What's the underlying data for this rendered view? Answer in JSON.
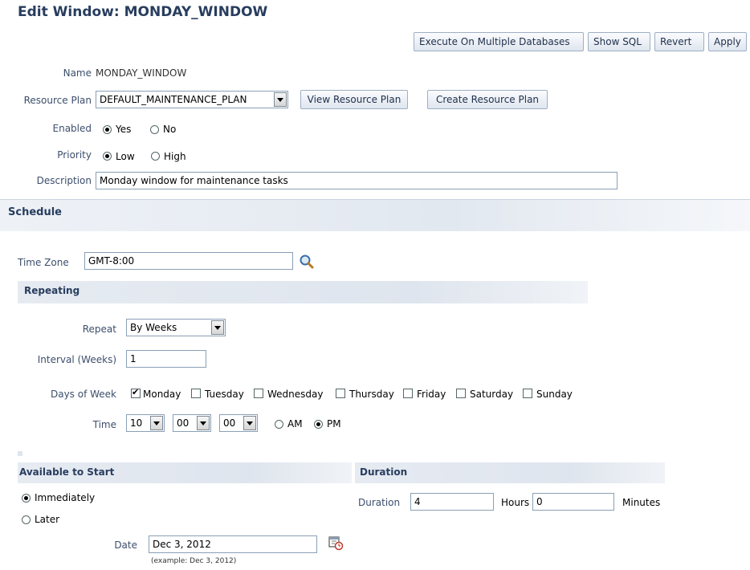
{
  "page": {
    "title": "Edit Window: MONDAY_WINDOW",
    "buttons": {
      "execute": "Execute On Multiple Databases",
      "show_sql": "Show SQL",
      "revert": "Revert",
      "apply": "Apply"
    }
  },
  "general": {
    "name_label": "Name",
    "name_value": "MONDAY_WINDOW",
    "resource_plan_label": "Resource Plan",
    "resource_plan_value": "DEFAULT_MAINTENANCE_PLAN",
    "view_plan_button": "View Resource Plan",
    "create_plan_button": "Create Resource Plan",
    "enabled_label": "Enabled",
    "enabled_yes": "Yes",
    "enabled_no": "No",
    "enabled_selected": "Yes",
    "priority_label": "Priority",
    "priority_low": "Low",
    "priority_high": "High",
    "priority_selected": "Low",
    "description_label": "Description",
    "description_value": "Monday window for maintenance tasks"
  },
  "schedule": {
    "header": "Schedule",
    "timezone_label": "Time Zone",
    "timezone_value": "GMT-8:00",
    "repeating_header": "Repeating",
    "repeat_label": "Repeat",
    "repeat_value": "By Weeks",
    "interval_label": "Interval (Weeks)",
    "interval_value": "1",
    "days_label": "Days of Week",
    "days": [
      {
        "label": "Monday",
        "checked": true
      },
      {
        "label": "Tuesday",
        "checked": false
      },
      {
        "label": "Wednesday",
        "checked": false
      },
      {
        "label": "Thursday",
        "checked": false
      },
      {
        "label": "Friday",
        "checked": false
      },
      {
        "label": "Saturday",
        "checked": false
      },
      {
        "label": "Sunday",
        "checked": false
      }
    ],
    "time_label": "Time",
    "time_hour": "10",
    "time_minute": "00",
    "time_second": "00",
    "am_label": "AM",
    "pm_label": "PM",
    "ampm_selected": "PM"
  },
  "start": {
    "header": "Available to Start",
    "immediately": "Immediately",
    "later": "Later",
    "selected": "Immediately",
    "date_label": "Date",
    "date_value": "Dec 3, 2012",
    "date_hint": "(example: Dec 3, 2012)"
  },
  "duration": {
    "header": "Duration",
    "label": "Duration",
    "hours_value": "4",
    "hours_label": "Hours",
    "minutes_value": "0",
    "minutes_label": "Minutes"
  },
  "icons": {
    "search": "search-icon",
    "calendar": "calendar-icon"
  },
  "colors": {
    "title": "#283d5e",
    "label": "#3c4e6c",
    "section_bg": "#e2e8f0"
  }
}
